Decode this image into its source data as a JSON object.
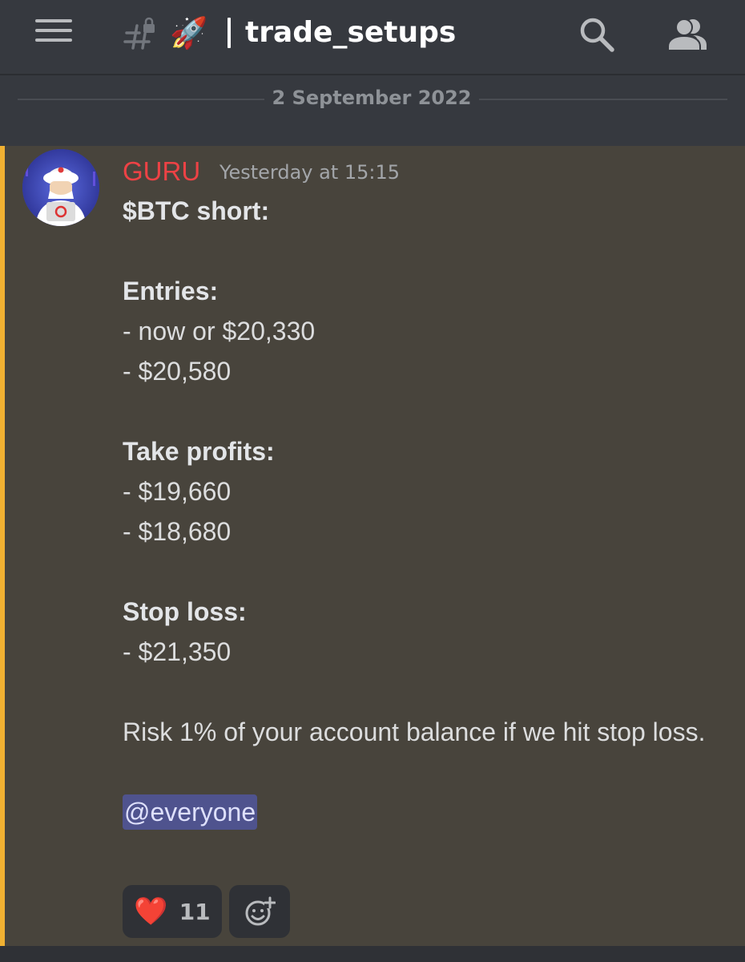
{
  "header": {
    "channel_emoji": "🚀",
    "channel_name": "trade_setups",
    "icons": [
      "hamburger-menu-icon",
      "locked-channel-hash-icon",
      "search-icon",
      "members-icon"
    ]
  },
  "date_divider": "2 September 2022",
  "message": {
    "author": "GURU",
    "timestamp": "Yesterday at 15:15",
    "title": "$BTC short:",
    "entries_heading": "Entries:",
    "entries": [
      "- now or $20,330",
      "- $20,580"
    ],
    "take_profits_heading": "Take profits:",
    "take_profits": [
      "- $19,660",
      "- $18,680"
    ],
    "stop_loss_heading": "Stop loss:",
    "stop_loss": [
      "- $21,350"
    ],
    "risk_note": "Risk 1% of your account balance if we hit stop loss.",
    "mention": "@everyone"
  },
  "reactions": [
    {
      "emoji": "❤️",
      "count": "11"
    }
  ],
  "colors": {
    "author": "#ed4245",
    "mention_highlight": "#f0b132",
    "background": "#36393f",
    "message_bg": "#48443c"
  }
}
